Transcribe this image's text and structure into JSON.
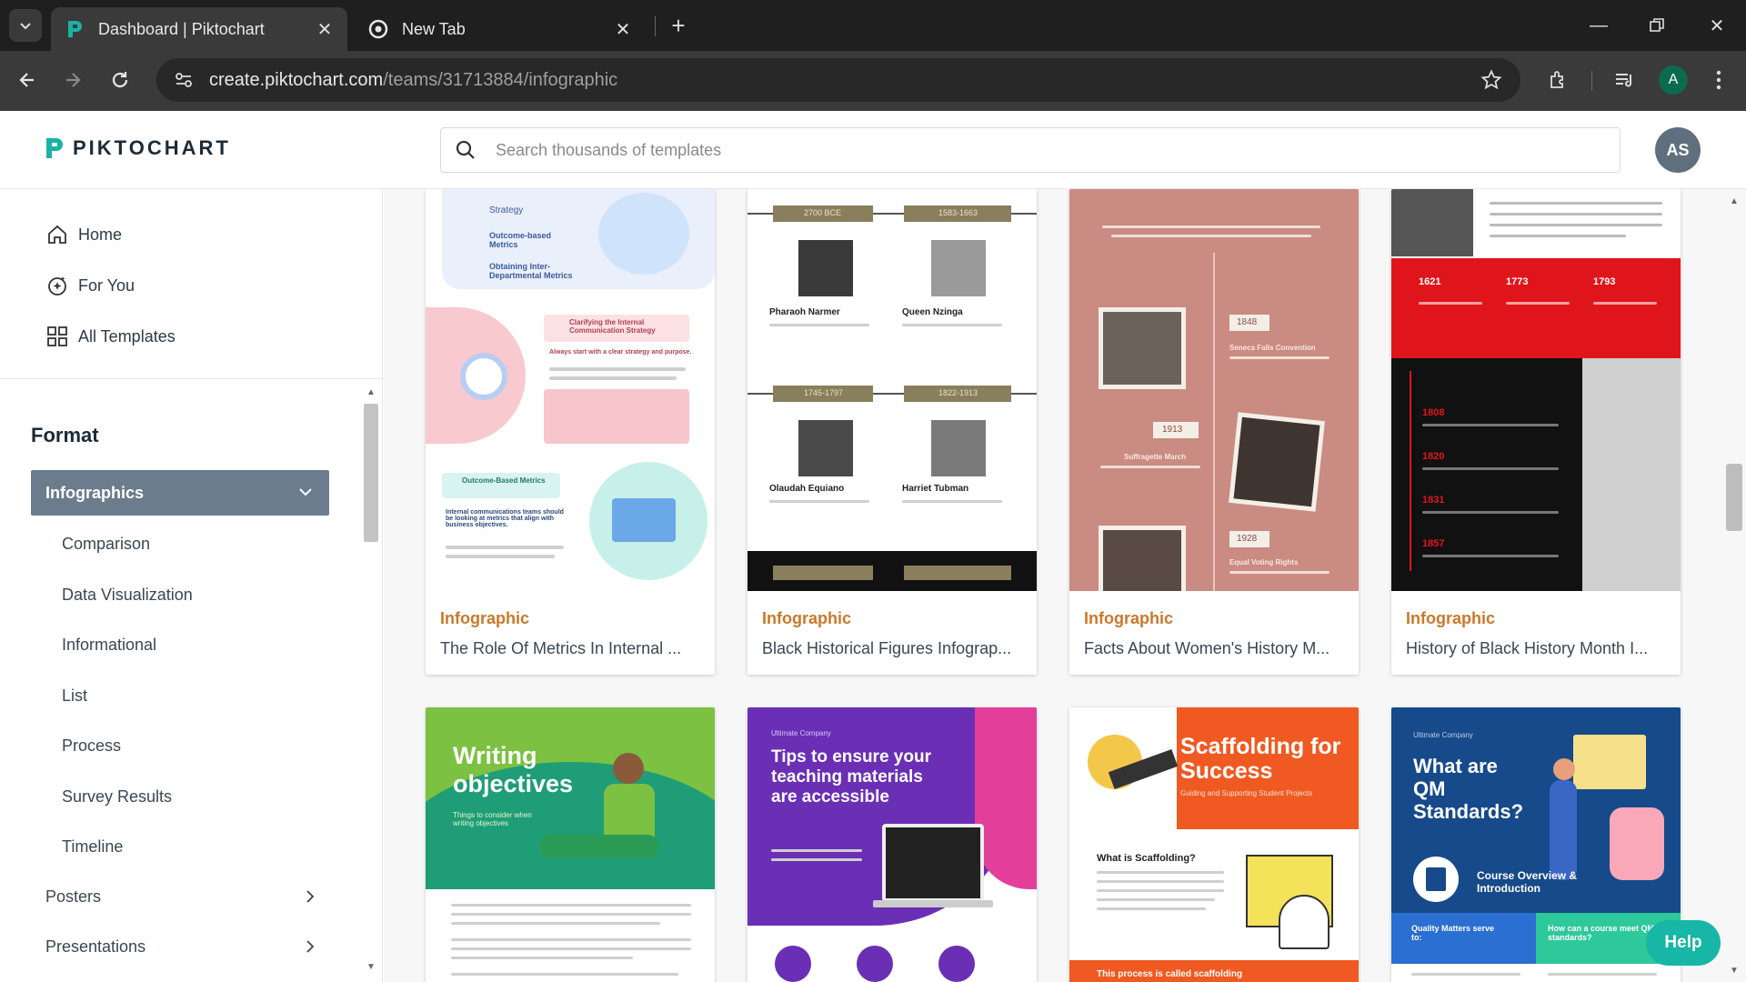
{
  "browser": {
    "tabs": [
      {
        "title": "Dashboard | Piktochart",
        "active": true
      },
      {
        "title": "New Tab",
        "active": false
      }
    ],
    "url_host": "create.piktochart.com",
    "url_path": "/teams/31713884/infographic",
    "profile_initial": "A"
  },
  "header": {
    "logo_text": "PIKTOCHART",
    "search_placeholder": "Search thousands of templates",
    "avatar_initials": "AS"
  },
  "sidebar": {
    "nav": [
      {
        "label": "Home",
        "icon": "home-icon"
      },
      {
        "label": "For You",
        "icon": "sparkle-icon"
      },
      {
        "label": "All Templates",
        "icon": "grid-icon"
      }
    ],
    "format_label": "Format",
    "active_category": "Infographics",
    "subcategories": [
      "Comparison",
      "Data Visualization",
      "Informational",
      "List",
      "Process",
      "Survey Results",
      "Timeline"
    ],
    "categories": [
      "Posters",
      "Presentations"
    ]
  },
  "cards_row1": [
    {
      "type": "Infographic",
      "name": "The Role Of Metrics In Internal ..."
    },
    {
      "type": "Infographic",
      "name": "Black Historical Figures Infograp..."
    },
    {
      "type": "Infographic",
      "name": "Facts About Women's History M..."
    },
    {
      "type": "Infographic",
      "name": "History of Black History Month I..."
    }
  ],
  "thumbs": {
    "t1": {
      "strategy": "Strategy",
      "outcome": "Outcome-based Metrics",
      "obtaining": "Obtaining Inter-Departmental Metrics",
      "clarify": "Clarifying the Internal Communication Strategy",
      "always": "Always start with a clear strategy and purpose.",
      "outcome2": "Outcome-Based Metrics",
      "internal": "Internal communications teams should be looking at metrics that align with business objectives."
    },
    "t2": {
      "date1": "2700 BCE",
      "date2": "1583-1663",
      "date3": "1745-1797",
      "date4": "1822-1913",
      "name1": "Pharaoh Narmer",
      "name2": "Queen Nzinga",
      "name3": "Olaudah Equiano",
      "name4": "Harriet Tubman"
    },
    "t3": {
      "y1848": "1848",
      "seneca": "Seneca Falls Convention",
      "y1913": "1913",
      "march": "Suffragette March",
      "y1928": "1928",
      "equal": "Equal Voting Rights"
    },
    "t4": {
      "y1621": "1621",
      "y1773": "1773",
      "y1793": "1793",
      "y1808": "1808",
      "y1820": "1820",
      "y1831": "1831",
      "y1857": "1857"
    },
    "t5": {
      "title": "Writing objectives",
      "sub": "Things to consider when writing objectives"
    },
    "t6": {
      "company": "Ultimate Company",
      "title": "Tips to ensure your teaching materials are accessible"
    },
    "t7": {
      "title": "Scaffolding for Success",
      "sub": "Guiding and Supporting Student Projects",
      "what": "What is Scaffolding?",
      "bottom": "This process is called scaffolding"
    },
    "t8": {
      "company": "Ultimate Company",
      "title": "What are QM Standards?",
      "course": "Course Overview & Introduction",
      "quality": "Quality Matters serve to:",
      "how": "How can a course meet QM standards?"
    }
  },
  "help_label": "Help",
  "colors": {
    "accent": "#c9792b",
    "active_category": "#6b7c8c",
    "help": "#17b6a7",
    "logo": "#19b3a6"
  }
}
